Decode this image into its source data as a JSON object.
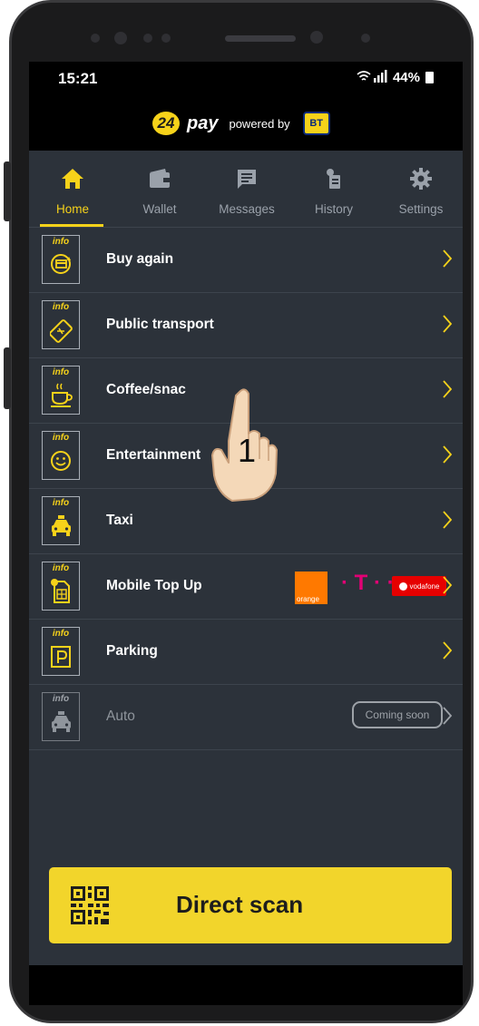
{
  "status_bar": {
    "time": "15:21",
    "battery": "44%"
  },
  "brand": {
    "logo_number": "24",
    "logo_word": "pay",
    "powered_by": "powered by",
    "partner": "BT"
  },
  "tabs": [
    {
      "label": "Home",
      "icon": "home-icon",
      "active": true
    },
    {
      "label": "Wallet",
      "icon": "wallet-icon",
      "active": false
    },
    {
      "label": "Messages",
      "icon": "message-icon",
      "active": false
    },
    {
      "label": "History",
      "icon": "receipt-icon",
      "active": false
    },
    {
      "label": "Settings",
      "icon": "gear-icon",
      "active": false
    }
  ],
  "info_tag": "info",
  "menu": [
    {
      "label": "Buy again",
      "icon": "rebuy-card-icon"
    },
    {
      "label": "Public transport",
      "icon": "ticket-icon"
    },
    {
      "label": "Coffee/snac",
      "icon": "coffee-cup-icon"
    },
    {
      "label": "Entertainment",
      "icon": "smiley-icon"
    },
    {
      "label": "Taxi",
      "icon": "taxi-icon"
    },
    {
      "label": "Mobile Top Up",
      "icon": "sim-card-icon"
    },
    {
      "label": "Parking",
      "icon": "parking-icon"
    },
    {
      "label": "Auto",
      "icon": "car-icon",
      "badge": "Coming soon",
      "disabled": true
    }
  ],
  "operators": {
    "orange": "orange",
    "telekom": "T",
    "vodafone": "vodafone"
  },
  "direct_scan": {
    "label": "Direct scan",
    "icon": "qr-code-icon"
  },
  "overlay": {
    "step": "1",
    "icon": "tap-hand-icon"
  },
  "colors": {
    "accent": "#f6d21a",
    "background": "#2c323a",
    "bar": "#000000"
  }
}
